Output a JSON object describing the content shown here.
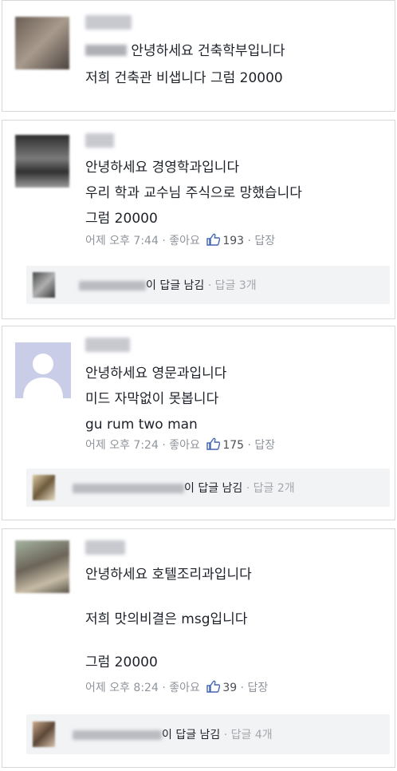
{
  "comments": [
    {
      "lines": [
        "안녕하세요 건축학부입니다",
        "저희 건축관 비샙니다 그럼 20000"
      ]
    },
    {
      "lines": [
        "안녕하세요 경영학과입니다",
        "우리 학과 교수님 주식으로 망했습니다",
        "그럼 20000"
      ],
      "time": "어제 오후 7:44",
      "like": "좋아요",
      "count": "193",
      "reply_action": "답장",
      "reply_summary": "이 답글 남김",
      "reply_count": "답글 3개"
    },
    {
      "lines": [
        "안녕하세요 영문과입니다",
        "미드 자막없이 못봅니다",
        "gu rum two man"
      ],
      "time": "어제 오후 7:24",
      "like": "좋아요",
      "count": "175",
      "reply_action": "답장",
      "reply_summary": "이 답글 남김",
      "reply_count": "답글 2개"
    },
    {
      "lines": [
        "안녕하세요 호텔조리과입니다",
        "저희 맛의비결은 msg입니다",
        "그럼 20000"
      ],
      "time": "어제 오후 8:24",
      "like": "좋아요",
      "count": "39",
      "reply_action": "답장",
      "reply_summary": "이 답글 남김",
      "reply_count": "답글 4개"
    }
  ],
  "separator": "·",
  "icons": {
    "like": "thumbs-up-icon"
  },
  "colors": {
    "link": "#4267b2",
    "meta": "#90949c",
    "reply_bg": "#f2f3f5"
  }
}
